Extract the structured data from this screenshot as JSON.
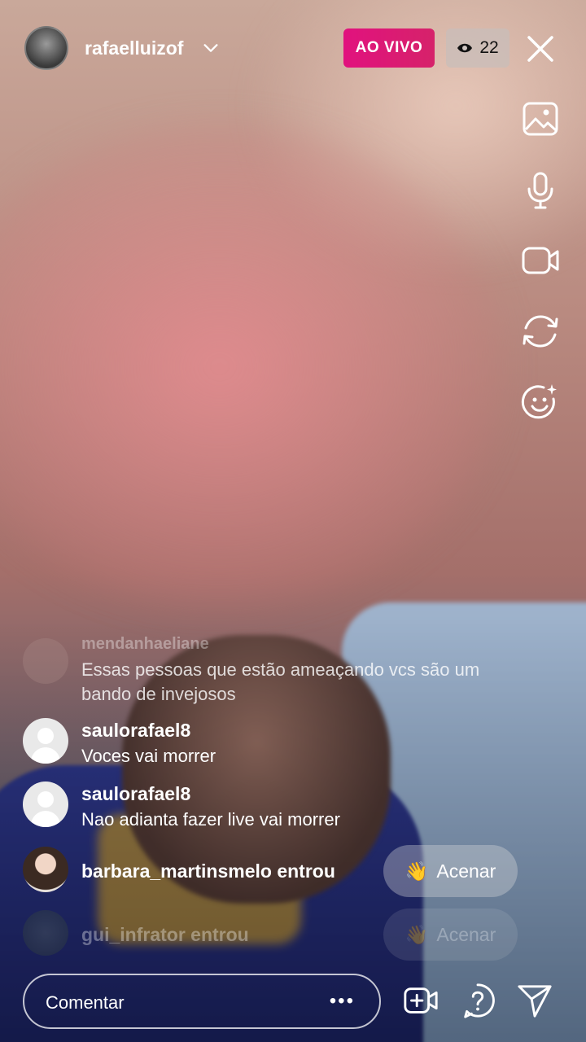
{
  "header": {
    "username": "rafaelluizof",
    "live_label": "AO VIVO",
    "viewer_count": "22"
  },
  "comments": [
    {
      "user": "mendanhaeliane",
      "text": "Essas pessoas que estão ameaçando vcs são um bando de invejosos"
    },
    {
      "user": "saulorafael8",
      "text": "Voces vai morrer"
    },
    {
      "user": "saulorafael8",
      "text": "Nao adianta fazer live vai morrer"
    }
  ],
  "joins": [
    {
      "text": "barbara_martinsmelo entrou",
      "wave_label": "Acenar"
    },
    {
      "text": "gui_infrator entrou",
      "wave_label": "Acenar"
    }
  ],
  "composer": {
    "placeholder": "Comentar",
    "more_label": "•••"
  },
  "icons": {
    "side": [
      "gallery-icon",
      "microphone-icon",
      "video-camera-icon",
      "flip-camera-icon",
      "face-effects-icon"
    ],
    "bottom": [
      "add-guest-icon",
      "question-icon",
      "send-icon"
    ]
  },
  "colors": {
    "live_badge": "#e1127e"
  }
}
